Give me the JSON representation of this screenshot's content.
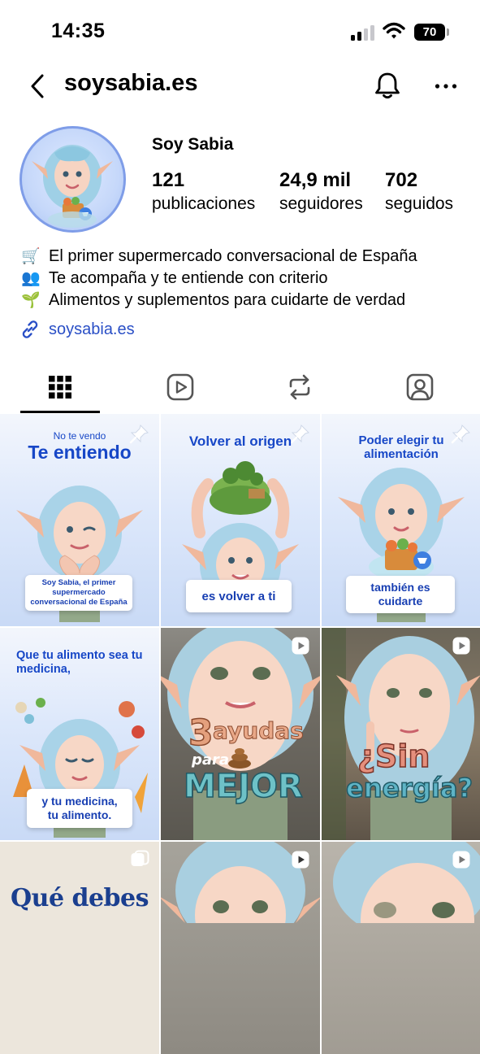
{
  "status": {
    "time": "14:35",
    "battery": "70"
  },
  "header": {
    "username": "soysabia.es"
  },
  "profile": {
    "display_name": "Soy Sabia",
    "stats": [
      {
        "value": "121",
        "label": "publicaciones"
      },
      {
        "value": "24,9 mil",
        "label": "seguidores"
      },
      {
        "value": "702",
        "label": "seguidos"
      }
    ],
    "bio": [
      {
        "emoji": "🛒",
        "text": "El primer supermercado conversacional de España"
      },
      {
        "emoji": "👥",
        "text": "Te acompaña y te entiende con criterio"
      },
      {
        "emoji": "🌱",
        "text": "Alimentos y suplementos para cuidarte de verdad"
      }
    ],
    "link": "soysabia.es"
  },
  "tabs": [
    "posts-grid-icon",
    "reels-icon",
    "reposts-icon",
    "tagged-icon"
  ],
  "posts": [
    {
      "top_small": "No te vendo",
      "title": "Te entiendo",
      "caption": "Soy Sabia, el primer supermercado conversacional de España"
    },
    {
      "title": "Volver al origen",
      "caption": "es volver a ti"
    },
    {
      "title": "Poder elegir tu alimentación",
      "caption": "también es cuidarte"
    },
    {
      "title": "Que tu alimento sea tu medicina,",
      "caption": "y tu medicina, tu alimento."
    },
    {
      "big_number": "3",
      "big_word": "ayudas",
      "small_word": "para",
      "big_bottom": "MEJOR"
    },
    {
      "big_top": "¿Sin",
      "big_bottom": "energía?"
    },
    {
      "title": "Qué debes"
    },
    {},
    {}
  ],
  "colors": {
    "accent_blue": "#1747c7",
    "link_blue": "#2a4fc6"
  }
}
